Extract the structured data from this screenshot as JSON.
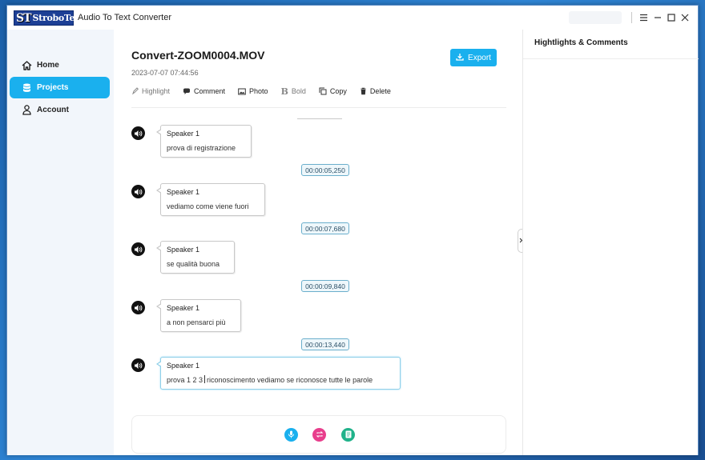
{
  "app": {
    "logo_mark": "ST",
    "logo_text": "StroboTech",
    "title": "Audio To Text Converter"
  },
  "sidebar": {
    "items": [
      {
        "label": "Home",
        "icon": "home-icon",
        "active": false
      },
      {
        "label": "Projects",
        "icon": "database-icon",
        "active": true
      },
      {
        "label": "Account",
        "icon": "user-icon",
        "active": false
      }
    ]
  },
  "document": {
    "title": "Convert-ZOOM0004.MOV",
    "date": "2023-07-07 07:44:56",
    "export_label": "Export"
  },
  "toolbar": {
    "highlight": "Highlight",
    "comment": "Comment",
    "photo": "Photo",
    "bold": "Bold",
    "copy": "Copy",
    "delete": "Delete"
  },
  "segments": [
    {
      "speaker": "Speaker 1",
      "text": "prova di registrazione"
    },
    {
      "timestamp": "00:00:05,250",
      "speaker": "Speaker 1",
      "text": "vediamo come viene fuori"
    },
    {
      "timestamp": "00:00:07,680",
      "speaker": "Speaker 1",
      "text": "se qualità buona"
    },
    {
      "timestamp": "00:00:09,840",
      "speaker": "Speaker 1",
      "text": "a non pensarci più"
    },
    {
      "timestamp": "00:00:13,440",
      "speaker": "Speaker 1",
      "text_before_cursor": "prova 1 2 3",
      "text_after_cursor": "riconoscimento vediamo se riconosce tutte le parole"
    }
  ],
  "right_panel": {
    "title": "Hightlights & Comments"
  },
  "colors": {
    "accent": "#1ab0ee",
    "record": "#1ab0ee",
    "swap": "#e83e8c",
    "notes": "#20b28a"
  }
}
